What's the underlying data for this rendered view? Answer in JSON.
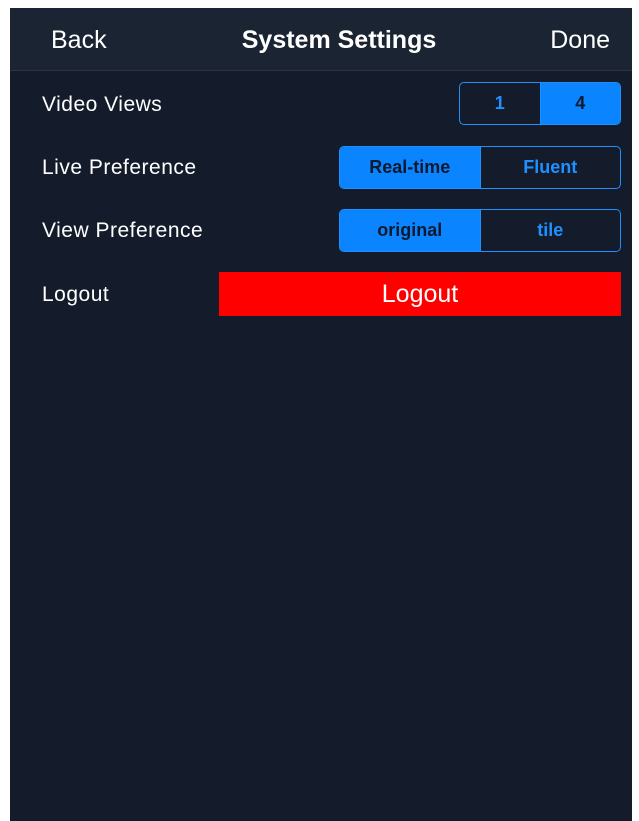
{
  "navbar": {
    "back_label": "Back",
    "title": "System Settings",
    "done_label": "Done"
  },
  "rows": {
    "video_views": {
      "label": "Video Views",
      "options": [
        "1",
        "4"
      ],
      "selected": "4"
    },
    "live_preference": {
      "label": "Live Preference",
      "options": [
        "Real-time",
        "Fluent"
      ],
      "selected": "Real-time"
    },
    "view_preference": {
      "label": "View Preference",
      "options": [
        "original",
        "tile"
      ],
      "selected": "original"
    },
    "logout": {
      "label": "Logout",
      "button_label": "Logout"
    }
  },
  "colors": {
    "background": "#141c2b",
    "navbar": "#1b2432",
    "accent": "#0a84ff",
    "logout_button": "#ff0000"
  }
}
